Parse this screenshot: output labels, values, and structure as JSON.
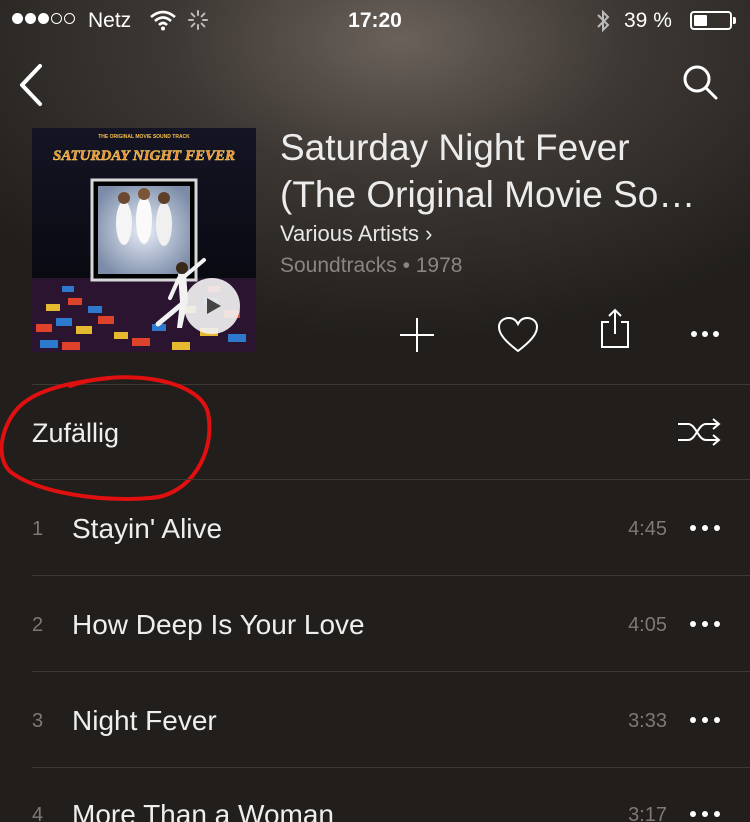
{
  "status_bar": {
    "carrier": "Netz",
    "time": "17:20",
    "battery_percent": "39 %",
    "battery_level": 0.39
  },
  "album": {
    "title_line1": "Saturday Night Fever",
    "title_line2": "(The Original Movie So…",
    "artist": "Various Artists ›",
    "meta": "Soundtracks • 1978",
    "cover_text_top": "THE ORIGINAL MOVIE SOUND TRACK",
    "cover_text_title": "SATURDAY NIGHT FEVER"
  },
  "shuffle": {
    "label": "Zufällig"
  },
  "tracks": [
    {
      "number": "1",
      "title": "Stayin' Alive",
      "duration": "4:45"
    },
    {
      "number": "2",
      "title": "How Deep Is Your Love",
      "duration": "4:05"
    },
    {
      "number": "3",
      "title": "Night Fever",
      "duration": "3:33"
    },
    {
      "number": "4",
      "title": "More Than a Woman",
      "duration": "3:17"
    }
  ],
  "colors": {
    "annotation": "#e01010",
    "background": "#211e1b"
  }
}
